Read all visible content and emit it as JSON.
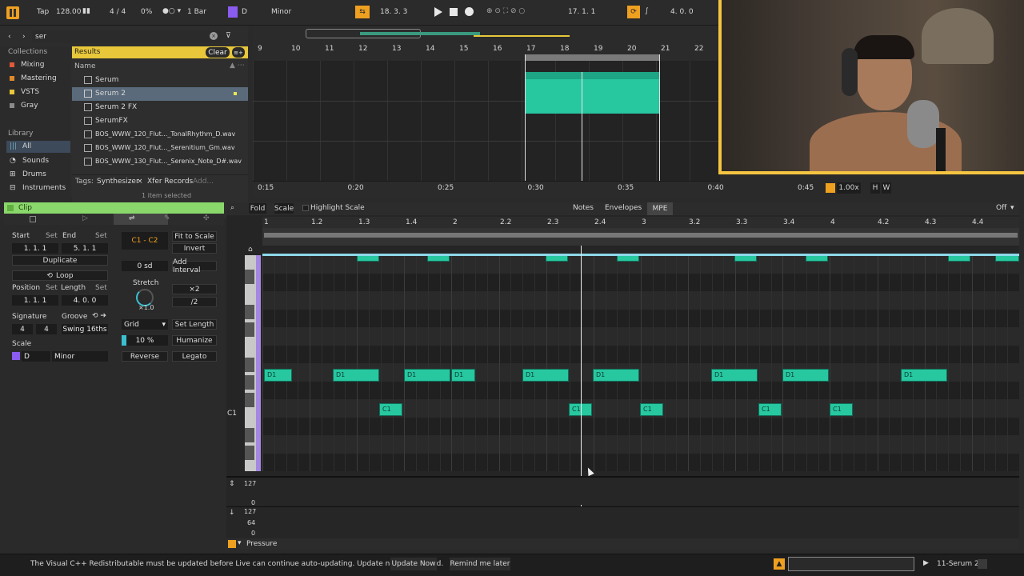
{
  "transport": {
    "tap": "Tap",
    "tempo": "128.00",
    "signature": "4 / 4",
    "swing": "0%",
    "quantize": "1 Bar",
    "key": "D",
    "scale": "Minor",
    "position": "18.  3.  3",
    "loop_start": "17.  1.  1",
    "loop_length": "4.  0.  0"
  },
  "browser": {
    "search_value": "ser",
    "collections_header": "Collections",
    "collections": [
      {
        "label": "Mixing",
        "color": "#e05a3a"
      },
      {
        "label": "Mastering",
        "color": "#e08a2a"
      },
      {
        "label": "VSTS",
        "color": "#e8c73a"
      },
      {
        "label": "Gray",
        "color": "#8a8a8a"
      }
    ],
    "library_header": "Library",
    "library": [
      {
        "label": "All",
        "icon": "grid-icon"
      },
      {
        "label": "Sounds",
        "icon": "sounds-icon"
      },
      {
        "label": "Drums",
        "icon": "drums-icon"
      },
      {
        "label": "Instruments",
        "icon": "instruments-icon"
      }
    ],
    "results_label": "Results",
    "clear_label": "Clear",
    "name_header": "Name",
    "items": [
      {
        "label": "Serum",
        "icon": "plugin-icon"
      },
      {
        "label": "Serum 2",
        "icon": "plugin-icon"
      },
      {
        "label": "Serum 2 FX",
        "icon": "plugin-icon"
      },
      {
        "label": "SerumFX",
        "icon": "plugin-icon"
      },
      {
        "label": "BOS_WWW_120_Flut..._TonalRhythm_D.wav",
        "icon": "audio-file-icon"
      },
      {
        "label": "BOS_WWW_120_Flut..._Serenitium_Gm.wav",
        "icon": "audio-file-icon"
      },
      {
        "label": "BOS_WWW_130_Flut..._Serenix_Note_D#.wav",
        "icon": "audio-file-icon"
      }
    ],
    "tags_label": "Tags:",
    "tag1": "Synthesizer",
    "tag2": "Xfer Records",
    "tag_add": "Add...",
    "selected_info": "1 item selected"
  },
  "arrangement": {
    "bars": [
      "9",
      "10",
      "11",
      "12",
      "13",
      "14",
      "15",
      "16",
      "17",
      "18",
      "19",
      "20",
      "21",
      "22"
    ],
    "times": [
      "0:15",
      "0:20",
      "0:25",
      "0:30",
      "0:35",
      "0:40",
      "0:45"
    ],
    "zoom": "1.00x",
    "h_label": "H",
    "w_label": "W"
  },
  "clip": {
    "title": "Clip",
    "start_label": "Start",
    "end_label": "End",
    "set_label": "Set",
    "start_value": "1.  1.  1",
    "end_value": "5.  1.  1",
    "duplicate_label": "Duplicate",
    "loop_label": "Loop",
    "position_label": "Position",
    "length_label": "Length",
    "position_value": "1.  1.  1",
    "length_value": "4.  0.  0",
    "signature_label": "Signature",
    "groove_label": "Groove",
    "sig_num": "4",
    "sig_den": "4",
    "swing_value": "Swing 16ths",
    "scale_label": "Scale",
    "scale_key": "D",
    "scale_mode": "Minor",
    "range": "C1 - C2",
    "fit_label": "Fit to Scale",
    "invert_label": "Invert",
    "sd_value": "0 sd",
    "add_interval_label": "Add Interval",
    "stretch_label": "Stretch",
    "x2_label": "×2",
    "div2_label": "/2",
    "stretch_value": "×1.0",
    "grid_label": "Grid",
    "set_length_label": "Set Length",
    "humanize_value": "10 %",
    "humanize_label": "Humanize",
    "reverse_label": "Reverse",
    "legato_label": "Legato"
  },
  "piano_roll": {
    "fold_label": "Fold",
    "scale_label": "Scale",
    "highlight_label": "Highlight Scale",
    "notes_tab": "Notes",
    "envelopes_tab": "Envelopes",
    "mpe_tab": "MPE",
    "off_label": "Off",
    "beats": [
      "1",
      "1.2",
      "1.3",
      "1.4",
      "2",
      "2.2",
      "2.3",
      "2.4",
      "3",
      "3.2",
      "3.3",
      "3.4",
      "4",
      "4.2",
      "4.3",
      "4.4"
    ],
    "c1_label": "C1",
    "d1_notes": [
      "D1",
      "D1",
      "D1",
      "D1",
      "D1",
      "D1",
      "D1",
      "D1",
      "D1"
    ],
    "c1_notes": [
      "C1",
      "C1",
      "C1",
      "C1",
      "C1"
    ],
    "vel_top": "127",
    "vel_zero": "0",
    "vel2_top": "127",
    "vel2_mid": "64",
    "vel2_zero": "0",
    "pressure_label": "Pressure"
  },
  "status": {
    "message": "The Visual C++ Redistributable must be updated before Live can continue auto-updating. Update now to proceed.",
    "update_now": "Update Now",
    "remind_later": "Remind me later",
    "track_name": "11-Serum 2"
  },
  "colors": {
    "accent": "#f5c542",
    "note": "#27c7a0",
    "clip_title_bar": "#8ad86b",
    "purple": "#8a5cf0"
  }
}
